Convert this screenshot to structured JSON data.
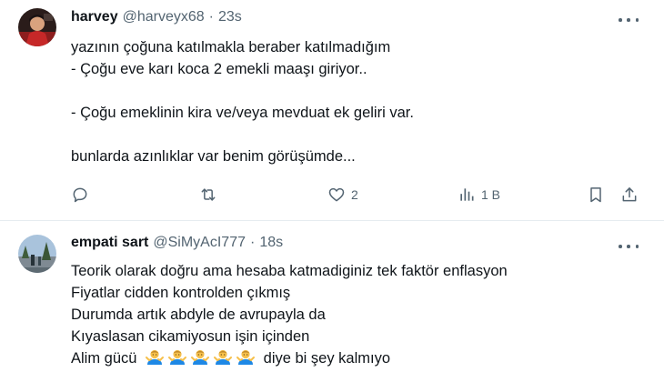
{
  "tweets": [
    {
      "author_name": "harvey",
      "handle": "@harveyx68",
      "separator": "·",
      "time": "23s",
      "text": "yazının çoğuna katılmakla beraber katılmadığım\n- Çoğu eve karı koca 2 emekli maaşı giriyor..\n\n- Çoğu emeklinin kira ve/veya mevduat ek geliri var.\n\nbunlarda azınlıklar var benim görüşümde...",
      "actions": {
        "reply_icon": "speech-bubble-icon",
        "retweet_icon": "retweet-icon",
        "like_icon": "heart-icon",
        "like_count": "2",
        "views_icon": "bar-chart-icon",
        "views_count": "1 B",
        "bookmark_icon": "bookmark-icon",
        "share_icon": "share-icon"
      }
    },
    {
      "author_name": "empati sart",
      "handle": "@SiMyAcI777",
      "separator": "·",
      "time": "18s",
      "lines": [
        "Teorik olarak doğru ama hesaba katmadiginiz tek faktör enflasyon",
        "Fiyatlar cidden kontrolden çıkmış",
        "Durumda artık abdyle de avrupayla da",
        "Kıyaslasan cikamiyosun işin içinden"
      ],
      "last_line_prefix": "Alim gücü",
      "last_line_emojis": [
        "man-shrugging-emoji",
        "man-shrugging-emoji",
        "man-shrugging-emoji",
        "man-shrugging-emoji",
        "man-shrugging-emoji"
      ],
      "last_line_suffix": "diye bi şey kalmıyo"
    }
  ],
  "colors": {
    "text": "#0f1419",
    "secondary": "#536471",
    "divider": "#e6ecf0"
  }
}
